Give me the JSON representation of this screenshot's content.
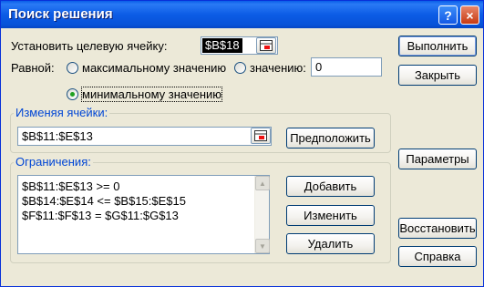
{
  "window": {
    "title": "Поиск решения",
    "help_glyph": "?",
    "close_glyph": "×"
  },
  "target": {
    "label": "Установить целевую ячейку:",
    "value": "$B$18"
  },
  "equal_to": {
    "label": "Равной:",
    "options": {
      "max": "максимальному значению",
      "value": "значению:",
      "min": "минимальному значению"
    },
    "selected": "min",
    "value_input": "0"
  },
  "changing_cells": {
    "label": "Изменяя ячейки:",
    "value": "$B$11:$E$13",
    "guess_button": "Предположить"
  },
  "constraints": {
    "label": "Ограничения:",
    "items": [
      "$B$11:$E$13 >= 0",
      "$B$14:$E$14 <= $B$15:$E$15",
      "$F$11:$F$13 = $G$11:$G$13"
    ],
    "add_button": "Добавить",
    "change_button": "Изменить",
    "delete_button": "Удалить"
  },
  "side_buttons": {
    "solve": "Выполнить",
    "close": "Закрыть",
    "options": "Параметры",
    "reset": "Восстановить",
    "help": "Справка"
  },
  "colors": {
    "title_bar": "#0a5ee8",
    "group_label": "#0046d5",
    "selection": "#000000",
    "radio_dot": "#21a121"
  }
}
